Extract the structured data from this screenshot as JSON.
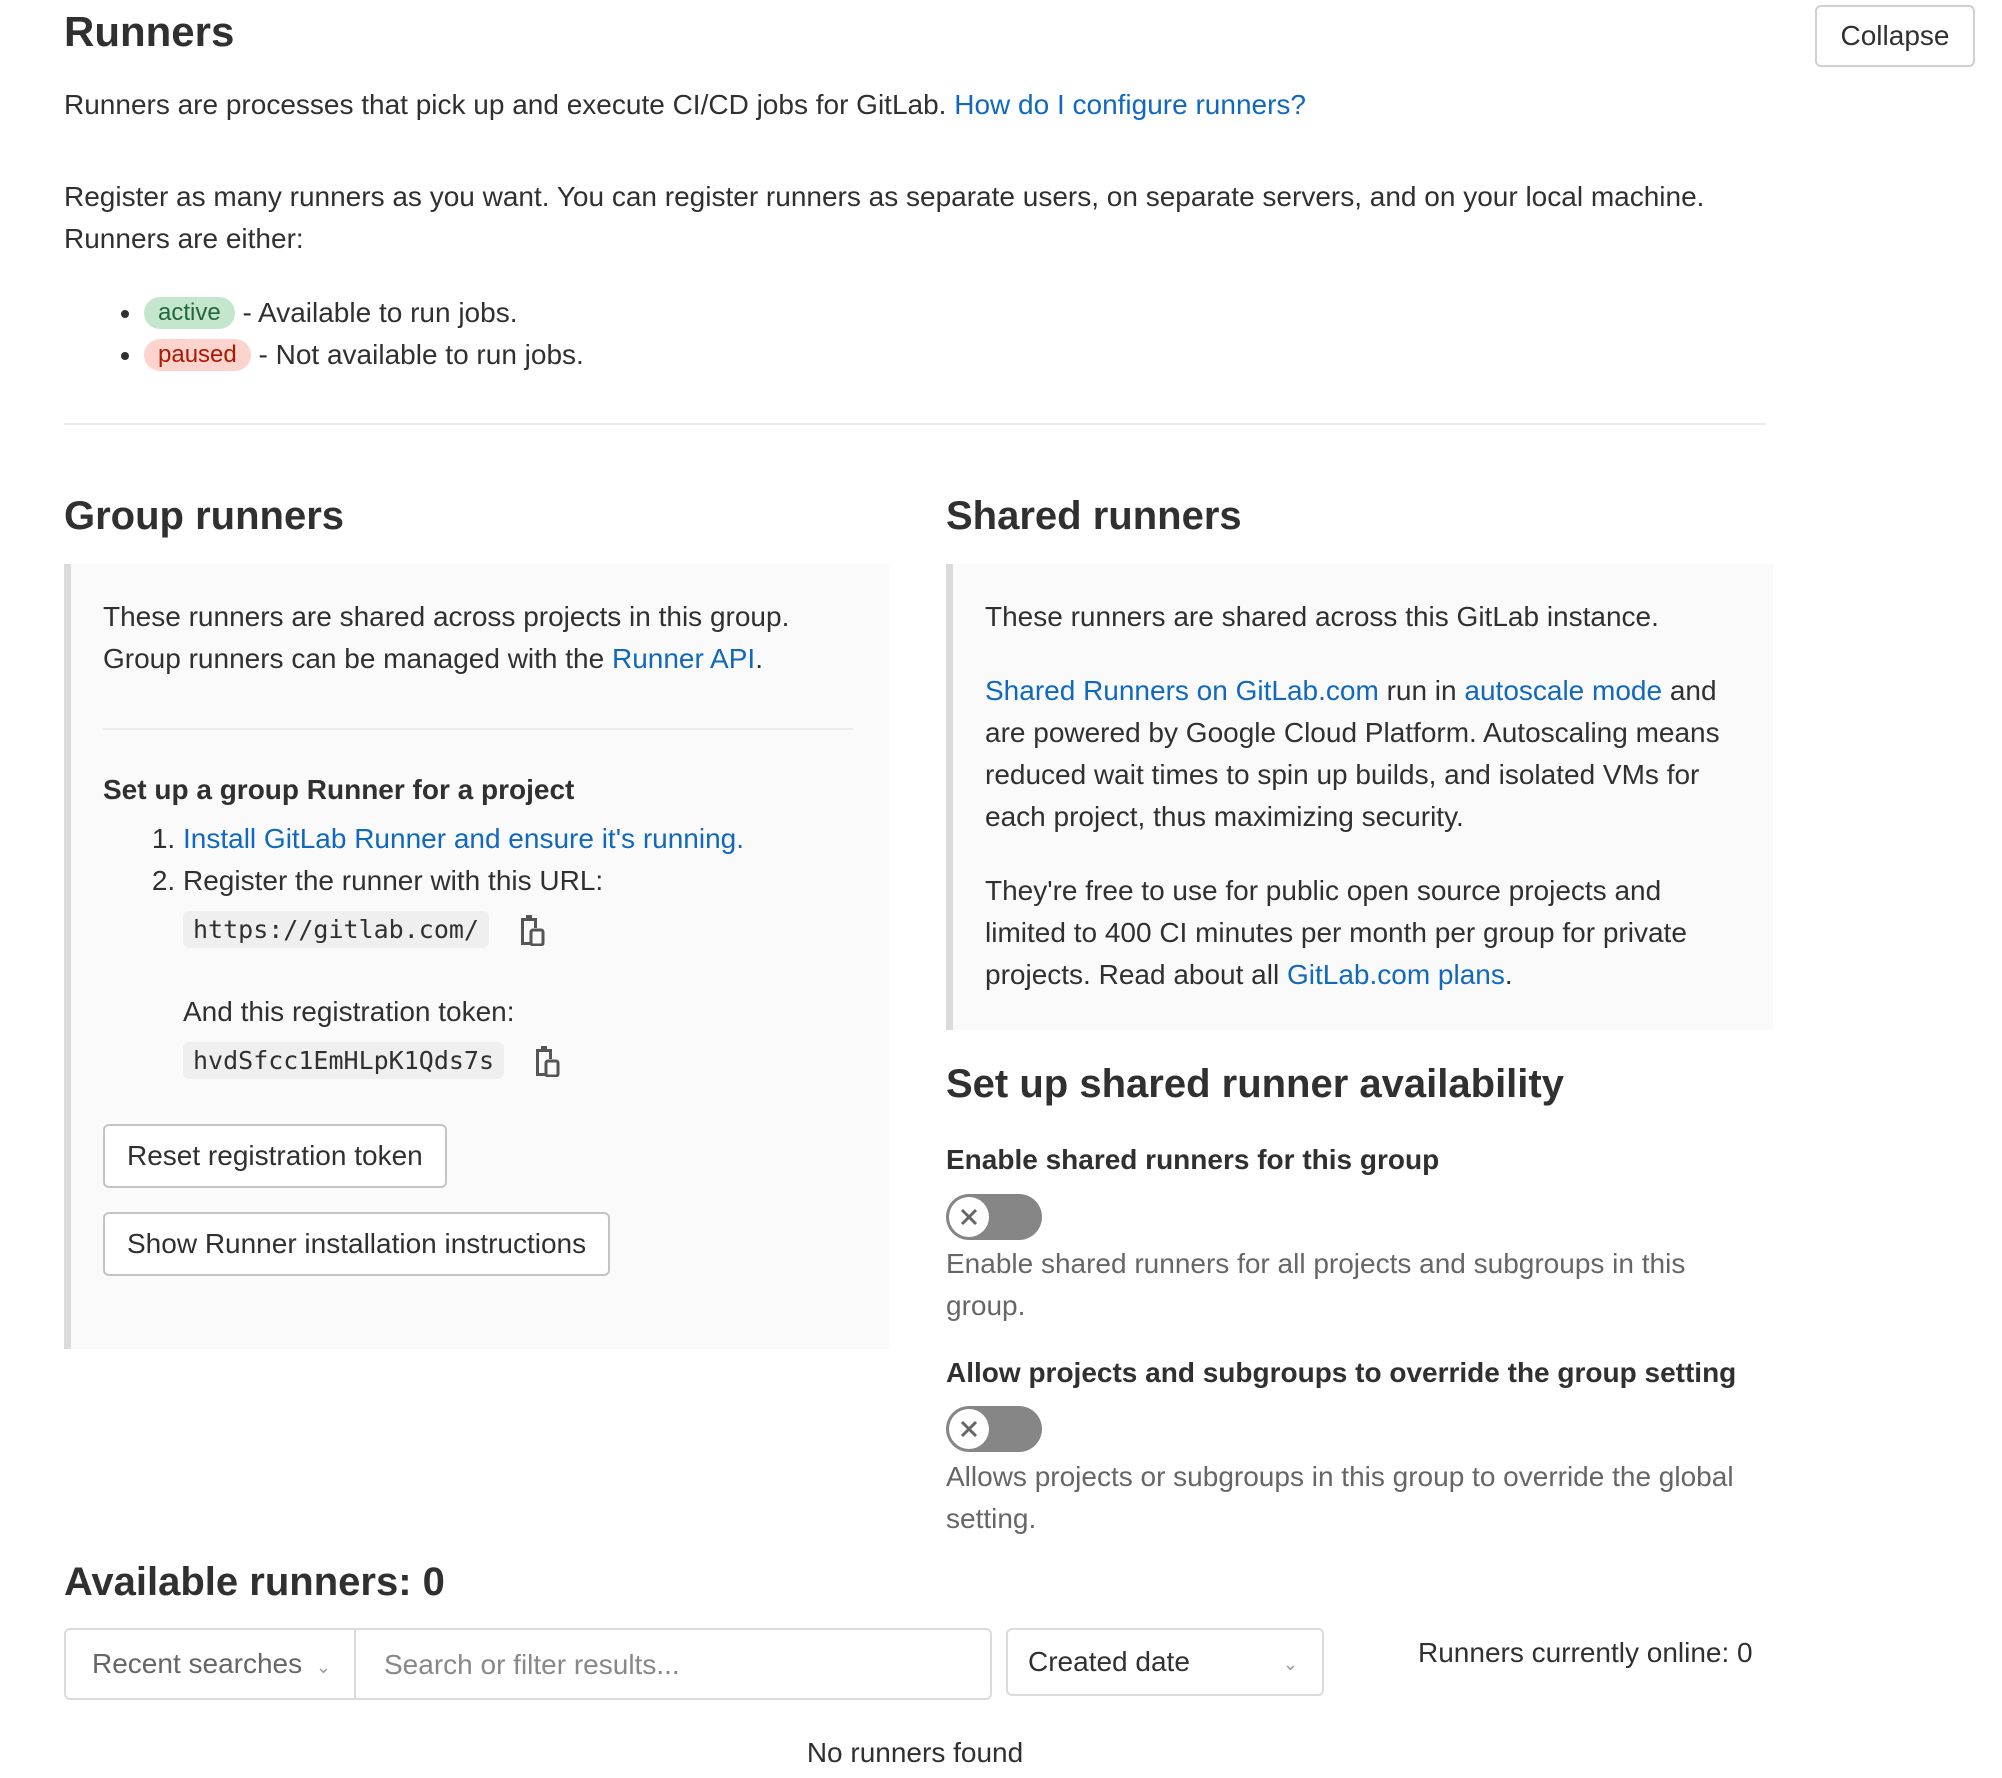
{
  "header": {
    "title": "Runners",
    "collapse_label": "Collapse",
    "intro_text": "Runners are processes that pick up and execute CI/CD jobs for GitLab.",
    "intro_link": "How do I configure runners?",
    "register_text_1": "Register as many runners as you want. You can register runners as separate users, on separate servers, and on your local machine.",
    "register_text_2": "Runners are either:",
    "states": [
      {
        "badge": "active",
        "description": "- Available to run jobs.",
        "color": "#c3e6cd"
      },
      {
        "badge": "paused",
        "description": "- Not available to run jobs.",
        "color": "#fdd4cd"
      }
    ]
  },
  "group_runners": {
    "heading": "Group runners",
    "desc_1": "These runners are shared across projects in this group.",
    "desc_2_prefix": "Group runners can be managed with the",
    "desc_2_link": "Runner API",
    "desc_2_suffix": ".",
    "setup_heading": "Set up a group Runner for a project",
    "step_1_link": "Install GitLab Runner and ensure it's running.",
    "step_2_text": "Register the runner with this URL:",
    "url": "https://gitlab.com/",
    "token_label": "And this registration token:",
    "token": "hvdSfcc1EmHLpK1Qds7s",
    "reset_button": "Reset registration token",
    "instructions_button": "Show Runner installation instructions"
  },
  "shared_runners": {
    "heading": "Shared runners",
    "desc_1": "These runners are shared across this GitLab instance.",
    "link_1": "Shared Runners on GitLab.com",
    "mid_text": "run in",
    "link_2": "autoscale mode",
    "desc_2": "and are powered by Google Cloud Platform. Autoscaling means reduced wait times to spin up builds, and isolated VMs for each project, thus maximizing security.",
    "desc_3": "They're free to use for public open source projects and limited to 400 CI minutes per month per group for private projects. Read about all",
    "link_3": "GitLab.com plans",
    "desc_3_suffix": "."
  },
  "availability": {
    "heading": "Set up shared runner availability",
    "enable_label": "Enable shared runners for this group",
    "enable_state": "off",
    "enable_help": "Enable shared runners for all projects and subgroups in this group.",
    "override_label": "Allow projects and subgroups to override the group setting",
    "override_state": "off",
    "override_help": "Allows projects or subgroups in this group to override the global setting."
  },
  "available": {
    "heading": "Available runners: 0",
    "recent_searches": "Recent searches",
    "search_placeholder": "Search or filter results...",
    "sort_value": "Created date",
    "online_text": "Runners currently online: 0",
    "empty_text": "No runners found"
  }
}
